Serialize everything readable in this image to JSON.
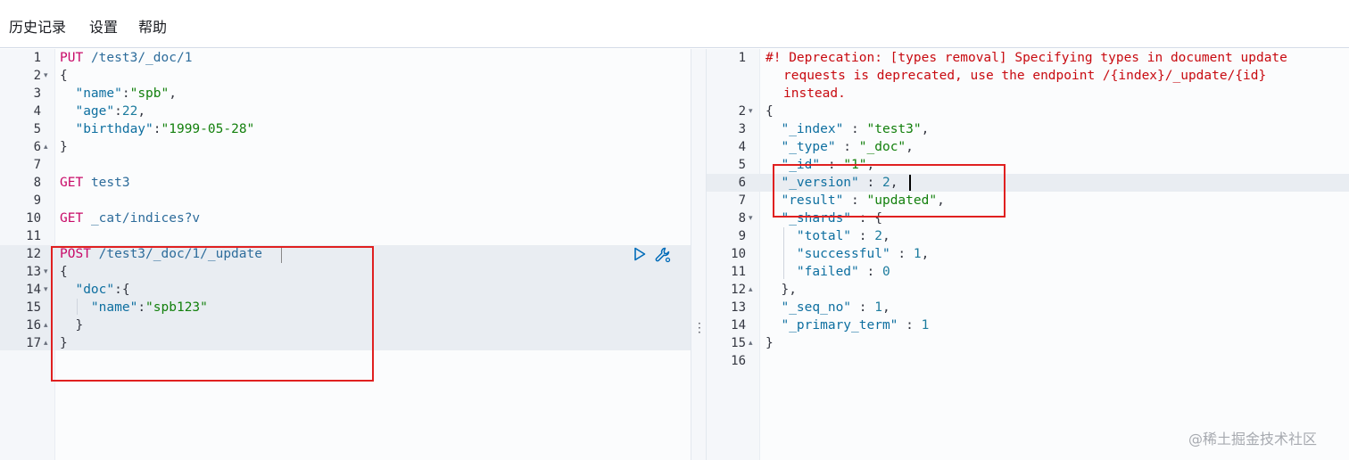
{
  "menu": {
    "history": "历史记录",
    "settings": "设置",
    "help": "帮助"
  },
  "request_editor": {
    "lines": [
      {
        "num": "1",
        "fold": ""
      },
      {
        "num": "2",
        "fold": "▾"
      },
      {
        "num": "3",
        "fold": ""
      },
      {
        "num": "4",
        "fold": ""
      },
      {
        "num": "5",
        "fold": ""
      },
      {
        "num": "6",
        "fold": "▴"
      },
      {
        "num": "7",
        "fold": ""
      },
      {
        "num": "8",
        "fold": ""
      },
      {
        "num": "9",
        "fold": ""
      },
      {
        "num": "10",
        "fold": ""
      },
      {
        "num": "11",
        "fold": ""
      },
      {
        "num": "12",
        "fold": ""
      },
      {
        "num": "13",
        "fold": "▾"
      },
      {
        "num": "14",
        "fold": "▾"
      },
      {
        "num": "15",
        "fold": ""
      },
      {
        "num": "16",
        "fold": "▴"
      },
      {
        "num": "17",
        "fold": "▴"
      }
    ],
    "code": {
      "l1_method": "PUT",
      "l1_url": "/test3/_doc/1",
      "l2": "{",
      "l3_key": "\"name\"",
      "l3_val": "\"spb\"",
      "l4_key": "\"age\"",
      "l4_val": "22",
      "l5_key": "\"birthday\"",
      "l5_val": "\"1999-05-28\"",
      "l6": "}",
      "l8_method": "GET",
      "l8_url": "test3",
      "l10_method": "GET",
      "l10_url": "_cat/indices?v",
      "l12_method": "POST",
      "l12_url": "/test3/_doc/1/_update",
      "l13": "{",
      "l14_key": "\"doc\"",
      "l14_rest": ":{",
      "l15_key": "\"name\"",
      "l15_val": "\"spb123\"",
      "l16": "}",
      "l17": "}"
    }
  },
  "response_viewer": {
    "lines": [
      {
        "num": "1",
        "fold": ""
      },
      {
        "num": "2",
        "fold": "▾"
      },
      {
        "num": "3",
        "fold": ""
      },
      {
        "num": "4",
        "fold": ""
      },
      {
        "num": "5",
        "fold": ""
      },
      {
        "num": "6",
        "fold": ""
      },
      {
        "num": "7",
        "fold": ""
      },
      {
        "num": "8",
        "fold": "▾"
      },
      {
        "num": "9",
        "fold": ""
      },
      {
        "num": "10",
        "fold": ""
      },
      {
        "num": "11",
        "fold": ""
      },
      {
        "num": "12",
        "fold": "▴"
      },
      {
        "num": "13",
        "fold": ""
      },
      {
        "num": "14",
        "fold": ""
      },
      {
        "num": "15",
        "fold": "▴"
      },
      {
        "num": "16",
        "fold": ""
      }
    ],
    "code": {
      "w1": "#! Deprecation: [types removal] Specifying types in document update",
      "w2": "requests is deprecated, use the endpoint /{index}/_update/{id}",
      "w3": "instead.",
      "open": "{",
      "index_key": "\"_index\"",
      "index_val": "\"test3\"",
      "type_key": "\"_type\"",
      "type_val": "\"_doc\"",
      "id_key": "\"_id\"",
      "id_val": "\"1\"",
      "version_key": "\"_version\"",
      "version_val": "2",
      "result_key": "\"result\"",
      "result_val": "\"updated\"",
      "shards_key": "\"_shards\"",
      "total_key": "\"total\"",
      "total_val": "2",
      "successful_key": "\"successful\"",
      "successful_val": "1",
      "failed_key": "\"failed\"",
      "failed_val": "0",
      "shards_close": "},",
      "seq_key": "\"_seq_no\"",
      "seq_val": "1",
      "term_key": "\"_primary_term\"",
      "term_val": "1",
      "close": "}"
    }
  },
  "watermark": "@稀土掘金技术社区",
  "icons": {
    "run": "play-icon",
    "wrench": "wrench-icon",
    "resize": "vertical-dots-icon"
  },
  "colors": {
    "method": "#c80a68",
    "string": "#13800d",
    "key": "#0e6fa0",
    "annotation_box": "#e02020"
  }
}
